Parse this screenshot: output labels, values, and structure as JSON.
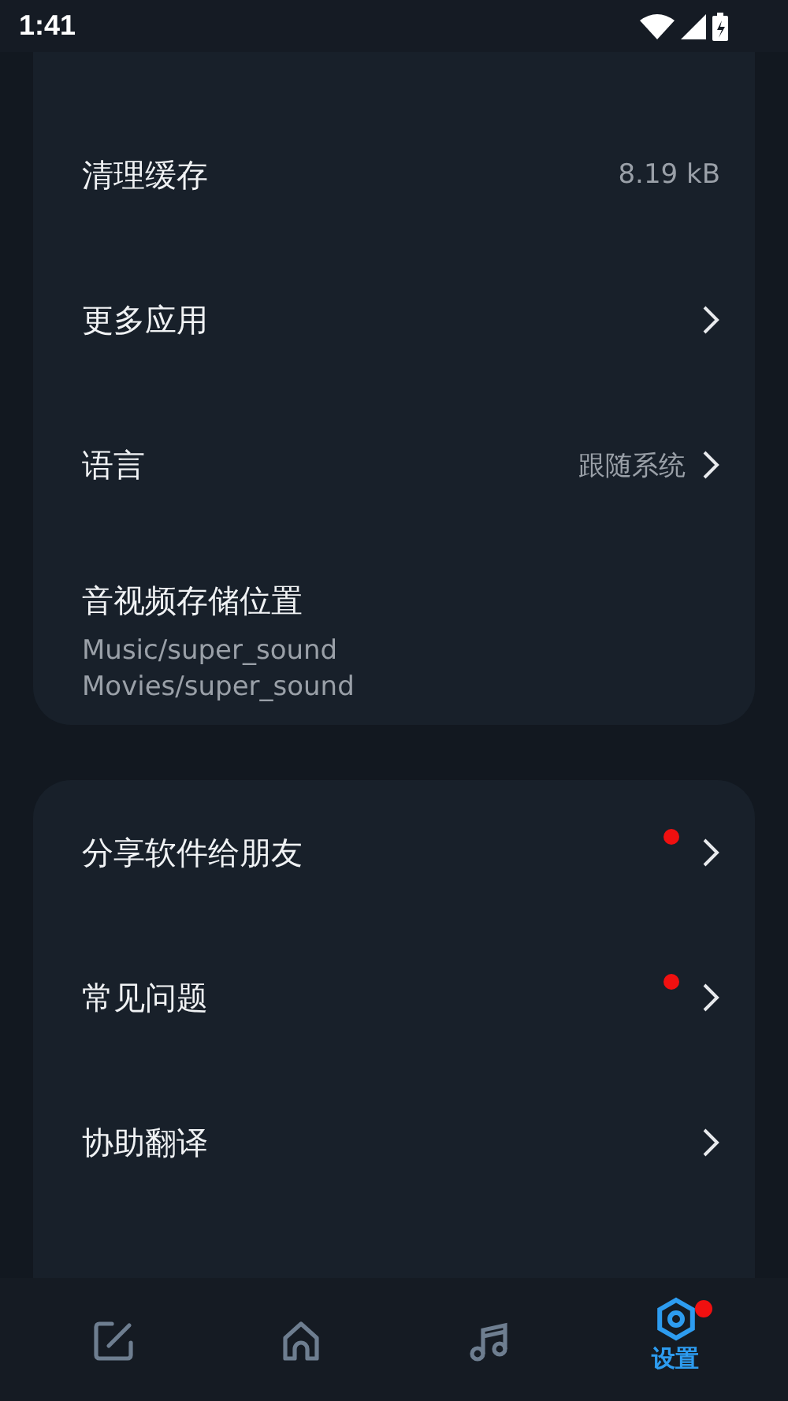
{
  "status_bar": {
    "time": "1:41"
  },
  "groups": [
    {
      "items": [
        {
          "kind": "value",
          "label": "清理缓存",
          "value": "8.19 kB",
          "badge": false
        },
        {
          "kind": "link",
          "label": "更多应用",
          "badge": false
        },
        {
          "kind": "link",
          "label": "语言",
          "value": "跟随系统",
          "badge": false
        },
        {
          "kind": "paths",
          "label": "音视频存储位置",
          "lines": [
            "Music/super_sound",
            "Movies/super_sound"
          ]
        }
      ]
    },
    {
      "items": [
        {
          "kind": "link",
          "label": "分享软件给朋友",
          "badge": true
        },
        {
          "kind": "link",
          "label": "常见问题",
          "badge": true
        },
        {
          "kind": "link",
          "label": "协助翻译",
          "badge": false
        }
      ]
    }
  ],
  "nav": [
    {
      "kind": "edit",
      "selected": false,
      "badge": false
    },
    {
      "kind": "home",
      "selected": false,
      "badge": false
    },
    {
      "kind": "music",
      "selected": false,
      "badge": false
    },
    {
      "kind": "settings",
      "selected": true,
      "label": "设置",
      "badge": true
    }
  ]
}
